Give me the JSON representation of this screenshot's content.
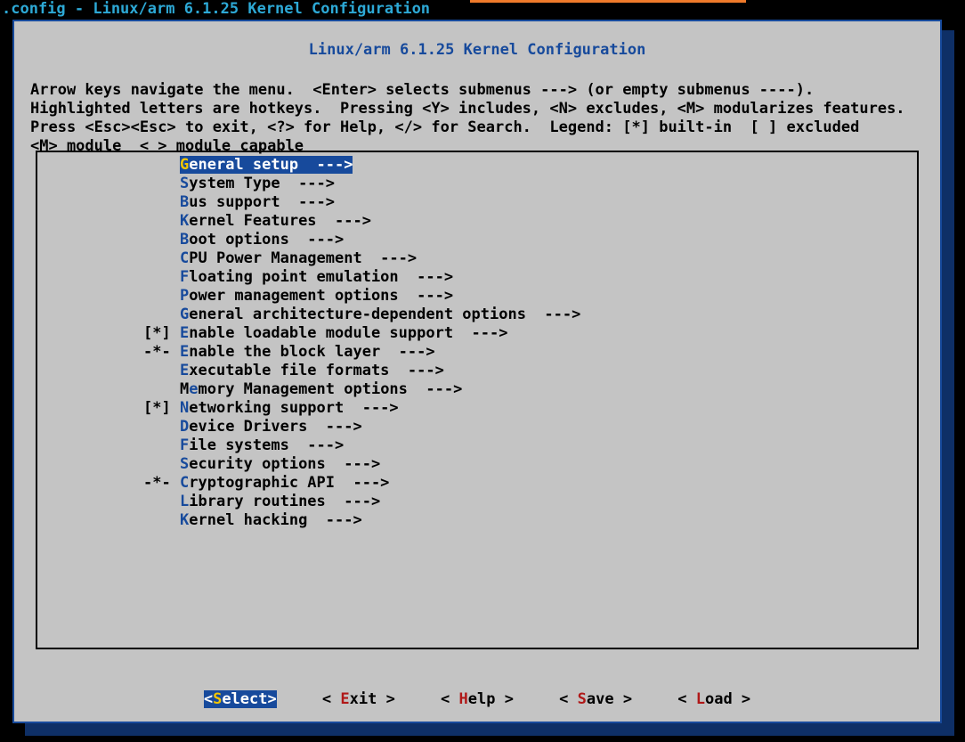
{
  "titlebar": ".config - Linux/arm 6.1.25 Kernel Configuration",
  "inner_title": "Linux/arm 6.1.25 Kernel Configuration",
  "help": {
    "l1": "Arrow keys navigate the menu.  <Enter> selects submenus ---> (or empty submenus ----).",
    "l2": "Highlighted letters are hotkeys.  Pressing <Y> includes, <N> excludes, <M> modularizes features.",
    "l3": "Press <Esc><Esc> to exit, <?> for Help, </> for Search.  Legend: [*] built-in  [ ] excluded",
    "l4": "<M> module  < > module capable"
  },
  "menu": [
    {
      "prefix": "    ",
      "hot": "G",
      "rest": "eneral setup  --->",
      "selected": true
    },
    {
      "prefix": "    ",
      "hot": "S",
      "rest": "ystem Type  --->"
    },
    {
      "prefix": "    ",
      "hot": "B",
      "rest": "us support  --->"
    },
    {
      "prefix": "    ",
      "hot": "K",
      "rest": "ernel Features  --->"
    },
    {
      "prefix": "    ",
      "hot": "B",
      "rest": "oot options  --->"
    },
    {
      "prefix": "    ",
      "hot": "C",
      "rest": "PU Power Management  --->"
    },
    {
      "prefix": "    ",
      "hot": "F",
      "rest": "loating point emulation  --->"
    },
    {
      "prefix": "    ",
      "hot": "P",
      "rest": "ower management options  --->"
    },
    {
      "prefix": "    ",
      "hot": "G",
      "rest": "eneral architecture-dependent options  --->"
    },
    {
      "prefix": "[*] ",
      "hot": "E",
      "rest": "nable loadable module support  --->"
    },
    {
      "prefix": "-*- ",
      "hot": "E",
      "rest": "nable the block layer  --->"
    },
    {
      "prefix": "    ",
      "hot": "E",
      "rest": "xecutable file formats  --->"
    },
    {
      "prefix": "    ",
      "pre": "M",
      "hot": "e",
      "rest": "mory Management options  --->"
    },
    {
      "prefix": "[*] ",
      "hot": "N",
      "rest": "etworking support  --->"
    },
    {
      "prefix": "    ",
      "hot": "D",
      "rest": "evice Drivers  --->"
    },
    {
      "prefix": "    ",
      "hot": "F",
      "rest": "ile systems  --->"
    },
    {
      "prefix": "    ",
      "hot": "S",
      "rest": "ecurity options  --->"
    },
    {
      "prefix": "-*- ",
      "hot": "C",
      "rest": "ryptographic API  --->"
    },
    {
      "prefix": "    ",
      "hot": "L",
      "rest": "ibrary routines  --->"
    },
    {
      "prefix": "    ",
      "hot": "K",
      "rest": "ernel hacking  --->"
    }
  ],
  "buttons": [
    {
      "left": "<",
      "hot": "S",
      "rest": "elect>",
      "active": true
    },
    {
      "left": "< ",
      "hot": "E",
      "rest": "xit >"
    },
    {
      "left": "< ",
      "hot": "H",
      "rest": "elp >"
    },
    {
      "left": "< ",
      "hot": "S",
      "rest": "ave >"
    },
    {
      "left": "< ",
      "hot": "L",
      "rest": "oad >"
    }
  ],
  "button_gap": "     "
}
